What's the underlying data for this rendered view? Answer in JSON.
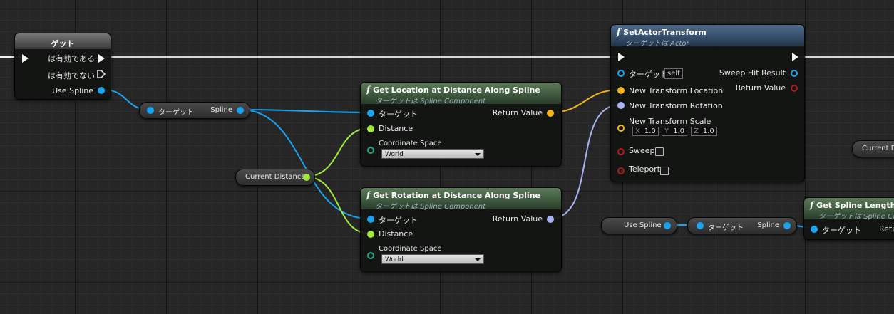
{
  "get_node": {
    "title": "ゲット",
    "is_valid": "は有効である",
    "is_not_valid": "は有効でない",
    "use_spline": "Use Spline"
  },
  "target_spline_getter_1": {
    "target": "ターゲット",
    "spline": "Spline"
  },
  "current_distance_var": "Current Distance",
  "get_location_node": {
    "title": "Get Location at Distance Along Spline",
    "subtitle": "ターゲットは Spline Component",
    "target": "ターゲット",
    "distance": "Distance",
    "coordinate_space": "Coordinate Space",
    "coordinate_value": "World",
    "return_value": "Return Value"
  },
  "get_rotation_node": {
    "title": "Get Rotation at Distance Along Spline",
    "subtitle": "ターゲットは Spline Component",
    "target": "ターゲット",
    "distance": "Distance",
    "coordinate_space": "Coordinate Space",
    "coordinate_value": "World",
    "return_value": "Return Value"
  },
  "set_actor_transform_node": {
    "title": "SetActorTransform",
    "subtitle": "ターゲットは Actor",
    "target": "ターゲット",
    "target_default": "self",
    "new_location": "New Transform Location",
    "new_rotation": "New Transform Rotation",
    "new_scale": "New Transform Scale",
    "scale_x_label": "X",
    "scale_x": "1.0",
    "scale_y_label": "Y",
    "scale_y": "1.0",
    "scale_z_label": "Z",
    "scale_z": "1.0",
    "sweep": "Sweep",
    "teleport": "Teleport",
    "sweep_hit_result": "Sweep Hit Result",
    "return_value": "Return Value"
  },
  "use_spline_var": "Use Spline",
  "target_spline_getter_2": {
    "target": "ターゲット",
    "spline": "Spline"
  },
  "get_spline_length_node": {
    "title": "Get Spline Length",
    "subtitle": "ターゲットは Spline Co",
    "target": "ターゲット",
    "return_value": "Retu"
  },
  "current_distance_var_right": "Current Di",
  "colors": {
    "exec": "#f2f2f2",
    "object_pin": "#1aa3f0",
    "float_pin": "#a2ea3a",
    "vector_pin": "#f2b51c",
    "rotator_pin": "#a8b3f5",
    "bool_pin": "#b2191c",
    "byte_enum_pin": "#23a58a",
    "pure_header": "#3f5a3e",
    "impure_header": "#36506c"
  }
}
